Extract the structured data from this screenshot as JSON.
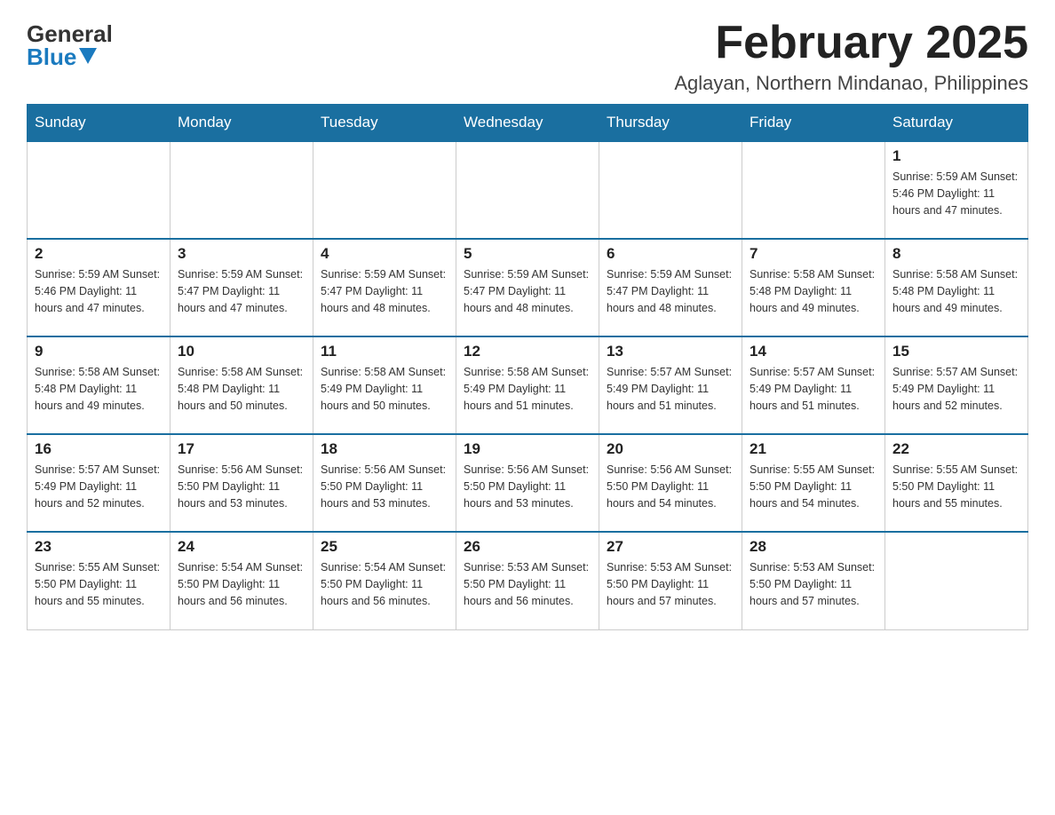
{
  "header": {
    "logo_general": "General",
    "logo_blue": "Blue",
    "month_title": "February 2025",
    "location": "Aglayan, Northern Mindanao, Philippines"
  },
  "days_of_week": [
    "Sunday",
    "Monday",
    "Tuesday",
    "Wednesday",
    "Thursday",
    "Friday",
    "Saturday"
  ],
  "weeks": [
    [
      {
        "day": "",
        "info": ""
      },
      {
        "day": "",
        "info": ""
      },
      {
        "day": "",
        "info": ""
      },
      {
        "day": "",
        "info": ""
      },
      {
        "day": "",
        "info": ""
      },
      {
        "day": "",
        "info": ""
      },
      {
        "day": "1",
        "info": "Sunrise: 5:59 AM\nSunset: 5:46 PM\nDaylight: 11 hours and 47 minutes."
      }
    ],
    [
      {
        "day": "2",
        "info": "Sunrise: 5:59 AM\nSunset: 5:46 PM\nDaylight: 11 hours and 47 minutes."
      },
      {
        "day": "3",
        "info": "Sunrise: 5:59 AM\nSunset: 5:47 PM\nDaylight: 11 hours and 47 minutes."
      },
      {
        "day": "4",
        "info": "Sunrise: 5:59 AM\nSunset: 5:47 PM\nDaylight: 11 hours and 48 minutes."
      },
      {
        "day": "5",
        "info": "Sunrise: 5:59 AM\nSunset: 5:47 PM\nDaylight: 11 hours and 48 minutes."
      },
      {
        "day": "6",
        "info": "Sunrise: 5:59 AM\nSunset: 5:47 PM\nDaylight: 11 hours and 48 minutes."
      },
      {
        "day": "7",
        "info": "Sunrise: 5:58 AM\nSunset: 5:48 PM\nDaylight: 11 hours and 49 minutes."
      },
      {
        "day": "8",
        "info": "Sunrise: 5:58 AM\nSunset: 5:48 PM\nDaylight: 11 hours and 49 minutes."
      }
    ],
    [
      {
        "day": "9",
        "info": "Sunrise: 5:58 AM\nSunset: 5:48 PM\nDaylight: 11 hours and 49 minutes."
      },
      {
        "day": "10",
        "info": "Sunrise: 5:58 AM\nSunset: 5:48 PM\nDaylight: 11 hours and 50 minutes."
      },
      {
        "day": "11",
        "info": "Sunrise: 5:58 AM\nSunset: 5:49 PM\nDaylight: 11 hours and 50 minutes."
      },
      {
        "day": "12",
        "info": "Sunrise: 5:58 AM\nSunset: 5:49 PM\nDaylight: 11 hours and 51 minutes."
      },
      {
        "day": "13",
        "info": "Sunrise: 5:57 AM\nSunset: 5:49 PM\nDaylight: 11 hours and 51 minutes."
      },
      {
        "day": "14",
        "info": "Sunrise: 5:57 AM\nSunset: 5:49 PM\nDaylight: 11 hours and 51 minutes."
      },
      {
        "day": "15",
        "info": "Sunrise: 5:57 AM\nSunset: 5:49 PM\nDaylight: 11 hours and 52 minutes."
      }
    ],
    [
      {
        "day": "16",
        "info": "Sunrise: 5:57 AM\nSunset: 5:49 PM\nDaylight: 11 hours and 52 minutes."
      },
      {
        "day": "17",
        "info": "Sunrise: 5:56 AM\nSunset: 5:50 PM\nDaylight: 11 hours and 53 minutes."
      },
      {
        "day": "18",
        "info": "Sunrise: 5:56 AM\nSunset: 5:50 PM\nDaylight: 11 hours and 53 minutes."
      },
      {
        "day": "19",
        "info": "Sunrise: 5:56 AM\nSunset: 5:50 PM\nDaylight: 11 hours and 53 minutes."
      },
      {
        "day": "20",
        "info": "Sunrise: 5:56 AM\nSunset: 5:50 PM\nDaylight: 11 hours and 54 minutes."
      },
      {
        "day": "21",
        "info": "Sunrise: 5:55 AM\nSunset: 5:50 PM\nDaylight: 11 hours and 54 minutes."
      },
      {
        "day": "22",
        "info": "Sunrise: 5:55 AM\nSunset: 5:50 PM\nDaylight: 11 hours and 55 minutes."
      }
    ],
    [
      {
        "day": "23",
        "info": "Sunrise: 5:55 AM\nSunset: 5:50 PM\nDaylight: 11 hours and 55 minutes."
      },
      {
        "day": "24",
        "info": "Sunrise: 5:54 AM\nSunset: 5:50 PM\nDaylight: 11 hours and 56 minutes."
      },
      {
        "day": "25",
        "info": "Sunrise: 5:54 AM\nSunset: 5:50 PM\nDaylight: 11 hours and 56 minutes."
      },
      {
        "day": "26",
        "info": "Sunrise: 5:53 AM\nSunset: 5:50 PM\nDaylight: 11 hours and 56 minutes."
      },
      {
        "day": "27",
        "info": "Sunrise: 5:53 AM\nSunset: 5:50 PM\nDaylight: 11 hours and 57 minutes."
      },
      {
        "day": "28",
        "info": "Sunrise: 5:53 AM\nSunset: 5:50 PM\nDaylight: 11 hours and 57 minutes."
      },
      {
        "day": "",
        "info": ""
      }
    ]
  ]
}
